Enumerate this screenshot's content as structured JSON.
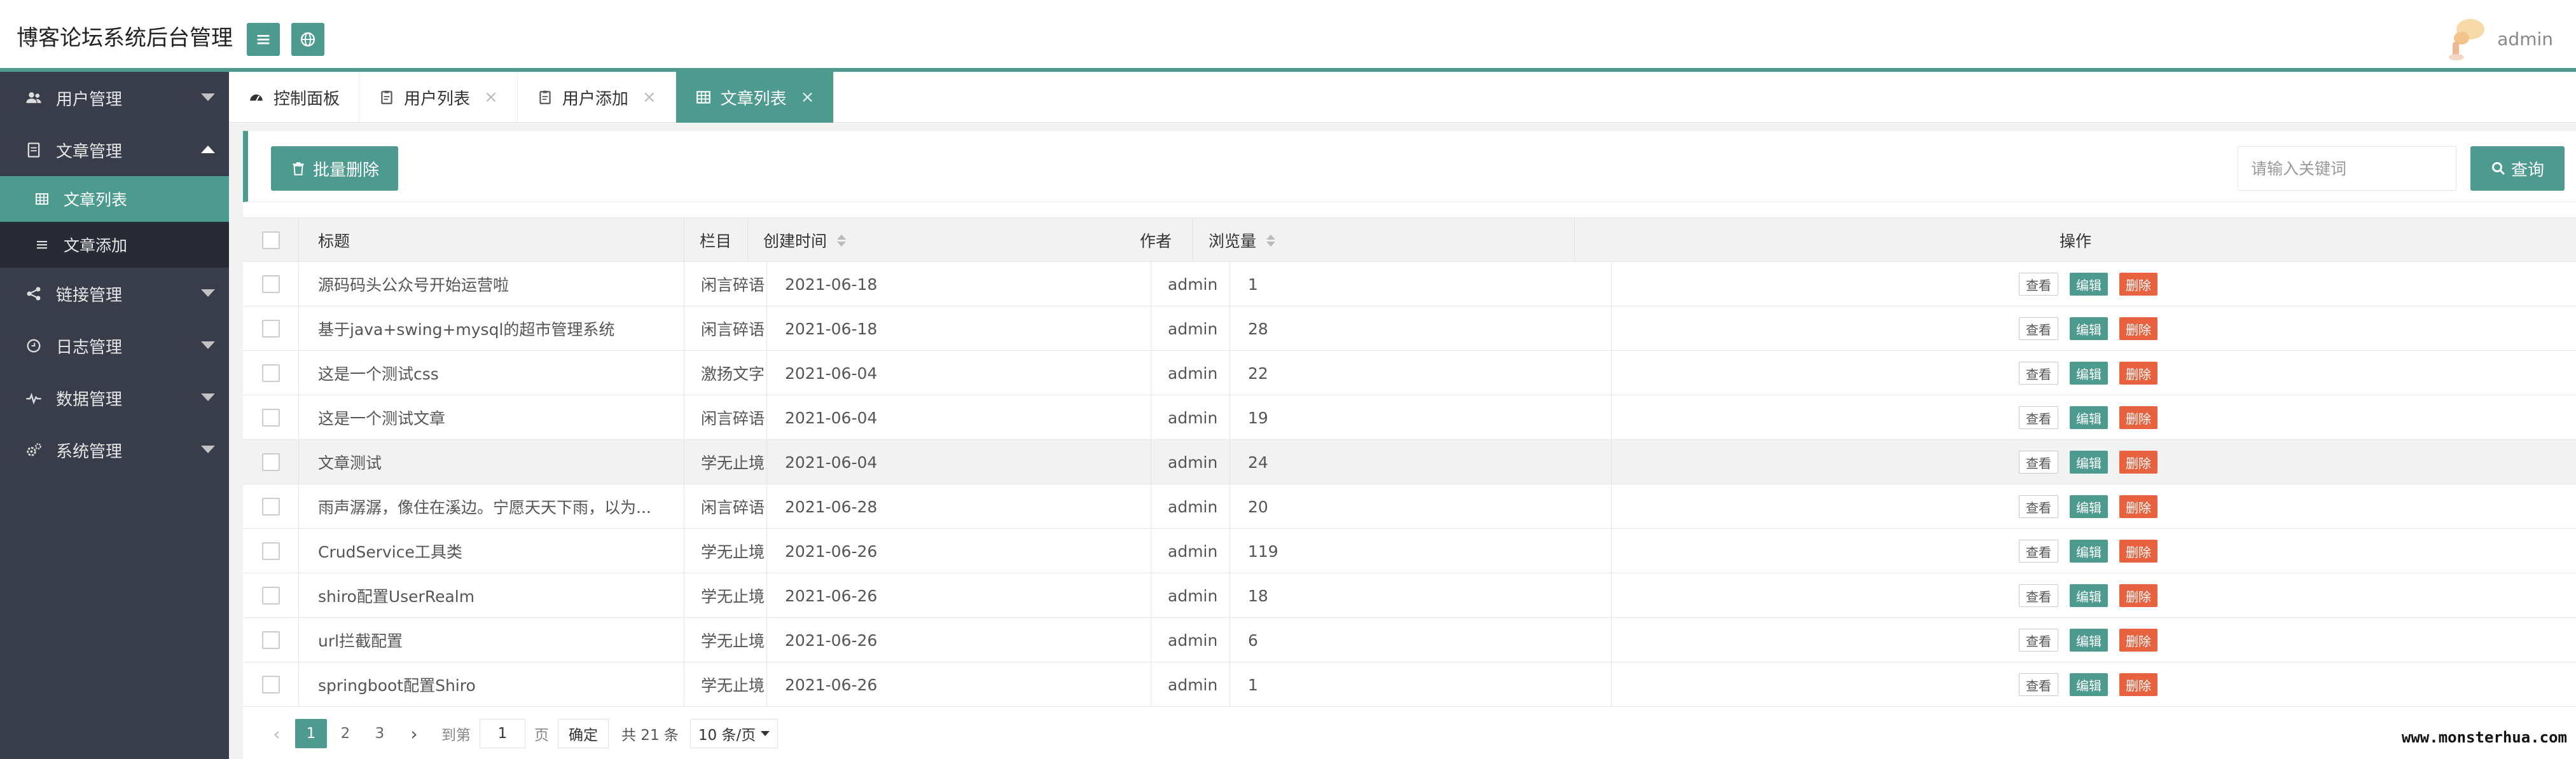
{
  "header": {
    "title": "博客论坛系统后台管理",
    "user": "admin"
  },
  "sidebar": {
    "items": [
      {
        "label": "用户管理",
        "icon": "users-icon",
        "expanded": false
      },
      {
        "label": "文章管理",
        "icon": "document-icon",
        "expanded": true,
        "children": [
          {
            "label": "文章列表",
            "icon": "table-icon",
            "active": true
          },
          {
            "label": "文章添加",
            "icon": "list-icon",
            "active": false
          }
        ]
      },
      {
        "label": "链接管理",
        "icon": "share-icon",
        "expanded": false
      },
      {
        "label": "日志管理",
        "icon": "log-icon",
        "expanded": false
      },
      {
        "label": "数据管理",
        "icon": "pulse-icon",
        "expanded": false
      },
      {
        "label": "系统管理",
        "icon": "gears-icon",
        "expanded": false
      }
    ]
  },
  "tabs": [
    {
      "label": "控制面板",
      "icon": "dashboard-icon",
      "closable": false,
      "active": false
    },
    {
      "label": "用户列表",
      "icon": "clipboard-icon",
      "closable": true,
      "active": false
    },
    {
      "label": "用户添加",
      "icon": "clipboard-icon",
      "closable": true,
      "active": false
    },
    {
      "label": "文章列表",
      "icon": "table-icon",
      "closable": true,
      "active": true
    }
  ],
  "tab_close_glyph": "×",
  "toolbar": {
    "batch_delete": "批量删除",
    "search_placeholder": "请输入关键词",
    "search_button": "查询"
  },
  "table": {
    "columns": {
      "title": "标题",
      "column": "栏目",
      "created": "创建时间",
      "author": "作者",
      "views": "浏览量",
      "actions": "操作"
    },
    "action_labels": {
      "view": "查看",
      "edit": "编辑",
      "delete": "删除"
    },
    "rows": [
      {
        "title": "源码码头公众号开始运营啦",
        "column": "闲言碎语",
        "created": "2021-06-18",
        "author": "admin",
        "views": "1"
      },
      {
        "title": "基于java+swing+mysql的超市管理系统",
        "column": "闲言碎语",
        "created": "2021-06-18",
        "author": "admin",
        "views": "28"
      },
      {
        "title": "这是一个测试css",
        "column": "激扬文字",
        "created": "2021-06-04",
        "author": "admin",
        "views": "22"
      },
      {
        "title": "这是一个测试文章",
        "column": "闲言碎语",
        "created": "2021-06-04",
        "author": "admin",
        "views": "19"
      },
      {
        "title": "文章测试",
        "column": "学无止境",
        "created": "2021-06-04",
        "author": "admin",
        "views": "24"
      },
      {
        "title": "雨声潺潺，像住在溪边。宁愿天天下雨，以为...",
        "column": "闲言碎语",
        "created": "2021-06-28",
        "author": "admin",
        "views": "20"
      },
      {
        "title": "CrudService工具类",
        "column": "学无止境",
        "created": "2021-06-26",
        "author": "admin",
        "views": "119"
      },
      {
        "title": "shiro配置UserRealm",
        "column": "学无止境",
        "created": "2021-06-26",
        "author": "admin",
        "views": "18"
      },
      {
        "title": "url拦截配置",
        "column": "学无止境",
        "created": "2021-06-26",
        "author": "admin",
        "views": "6"
      },
      {
        "title": "springboot配置Shiro",
        "column": "学无止境",
        "created": "2021-06-26",
        "author": "admin",
        "views": "1"
      }
    ]
  },
  "pager": {
    "prev": "‹",
    "pages": [
      "1",
      "2",
      "3"
    ],
    "current": "1",
    "next": "›",
    "goto_label": "到第",
    "goto_value": "1",
    "page_unit": "页",
    "confirm": "确定",
    "total": "共 21 条",
    "page_size": "10 条/页"
  },
  "watermark": "www.monsterhua.com",
  "colors": {
    "accent": "#4d9a8e",
    "danger": "#e8623f",
    "sidebar": "#393d49"
  }
}
